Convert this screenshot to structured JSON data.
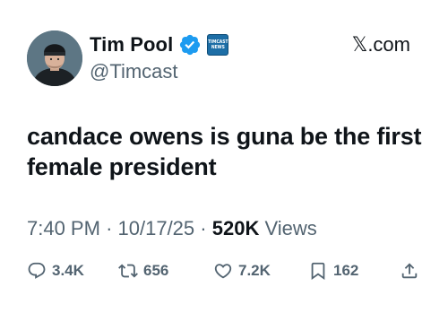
{
  "author": {
    "display_name": "Tim Pool",
    "handle": "@Timcast",
    "verified_icon": "verified-badge-icon",
    "verified_color": "#1d9bf0",
    "affiliate_badge_lines": [
      "TIMCAST",
      "NEWS"
    ]
  },
  "source": "𝕏.com",
  "tweet": {
    "text": "candace owens is guna be the first female president"
  },
  "meta": {
    "time": "7:40 PM",
    "separator": "·",
    "date": "10/17/25",
    "views_count": "520K",
    "views_label": "Views"
  },
  "actions": {
    "replies": "3.4K",
    "reposts": "656",
    "likes": "7.2K",
    "bookmarks": "162"
  },
  "colors": {
    "text": "#0f1419",
    "secondary": "#536471",
    "accent": "#1d9bf0"
  }
}
